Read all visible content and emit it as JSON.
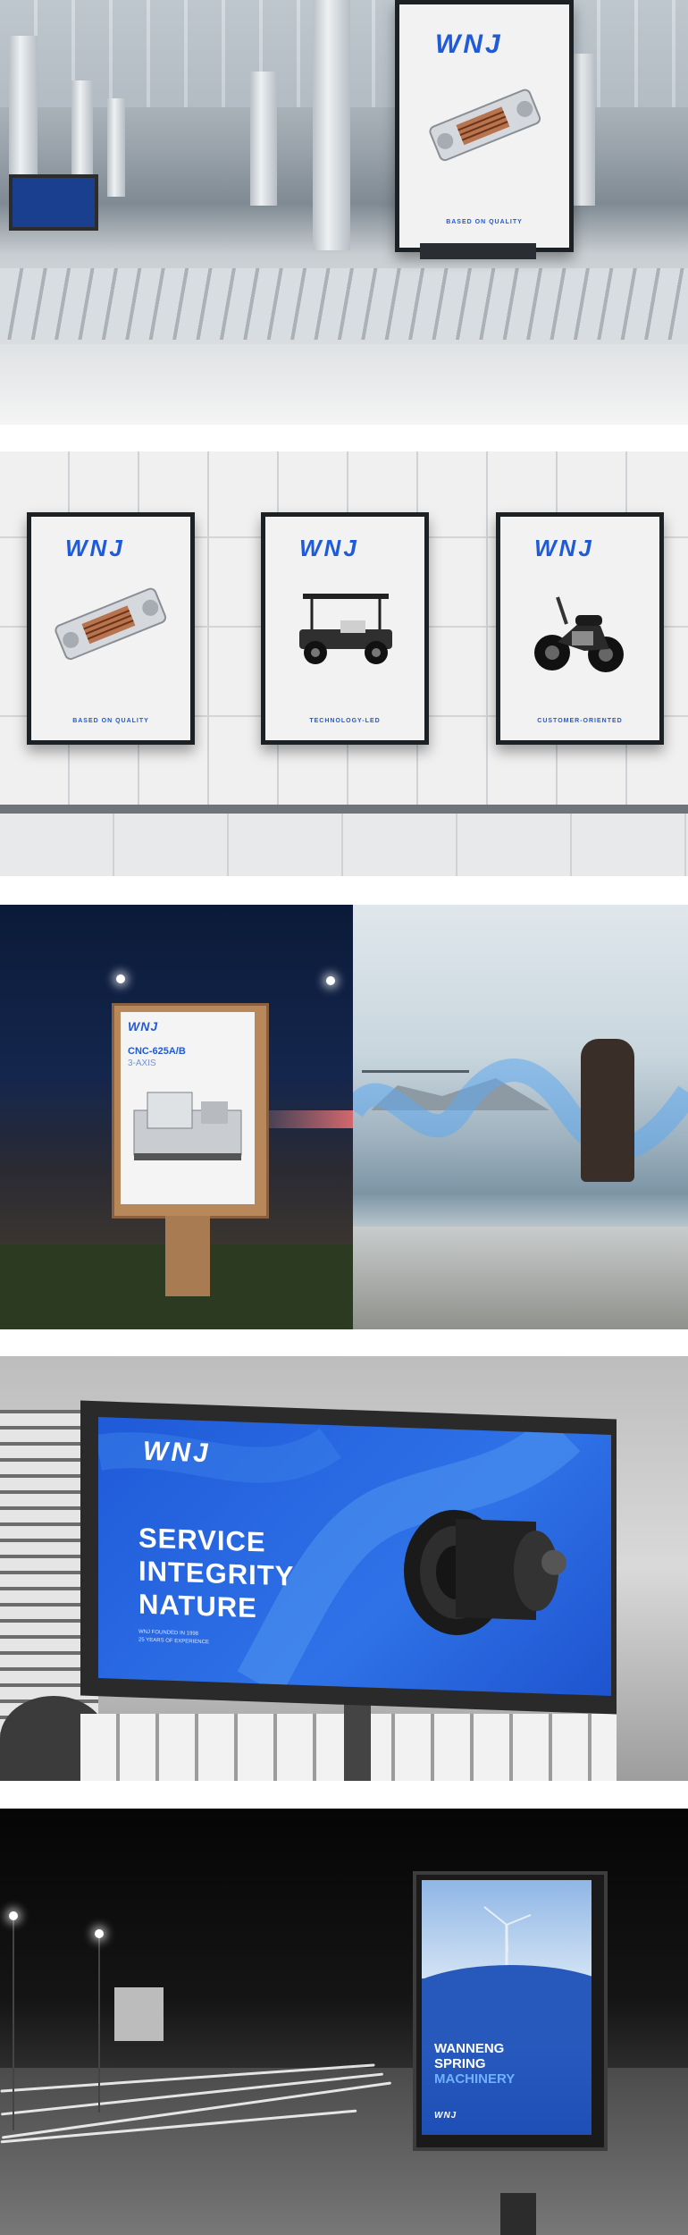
{
  "brand": {
    "logo": "WNJ",
    "color": "#1f5ad8"
  },
  "airport_poster": {
    "tagline": "BASED ON QUALITY"
  },
  "wall_posters": [
    {
      "tagline": "BASED ON QUALITY",
      "product": "gearbox"
    },
    {
      "tagline": "TECHNOLOGY-LED",
      "product": "golf-cart"
    },
    {
      "tagline": "CUSTOMER-ORIENTED",
      "product": "motorcycle"
    }
  ],
  "street_poster": {
    "model": "CNC-625A/B",
    "subtitle": "3-AXIS"
  },
  "billboard": {
    "lines": [
      "SERVICE",
      "INTEGRITY",
      "NATURE"
    ],
    "small": [
      "WNJ FOUNDED IN 1998",
      "25 YEARS OF EXPERIENCE"
    ]
  },
  "night_ad": {
    "lines": [
      "WANNENG",
      "SPRING"
    ],
    "highlight": "MACHINERY"
  }
}
